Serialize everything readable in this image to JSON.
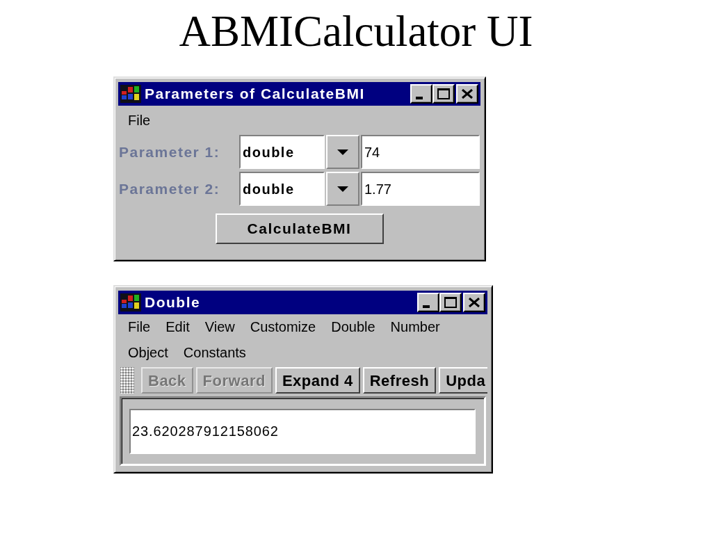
{
  "slide_title": "ABMICalculator UI",
  "parameters_window": {
    "title": "Parameters of CalculateBMI",
    "menu": [
      "File"
    ],
    "parameters": [
      {
        "label": "Parameter 1:",
        "type": "double",
        "value": "74"
      },
      {
        "label": "Parameter 2:",
        "type": "double",
        "value": "1.77"
      }
    ],
    "button": "CalculateBMI"
  },
  "result_window": {
    "title": "Double",
    "menu": [
      "File",
      "Edit",
      "View",
      "Customize",
      "Double",
      "Number",
      "Object",
      "Constants"
    ],
    "toolbar": [
      {
        "label": "Back",
        "disabled": true
      },
      {
        "label": "Forward",
        "disabled": true
      },
      {
        "label": "Expand 4",
        "disabled": false
      },
      {
        "label": "Refresh",
        "disabled": false
      },
      {
        "label": "Upda",
        "disabled": false
      }
    ],
    "output": "23.620287912158062"
  }
}
